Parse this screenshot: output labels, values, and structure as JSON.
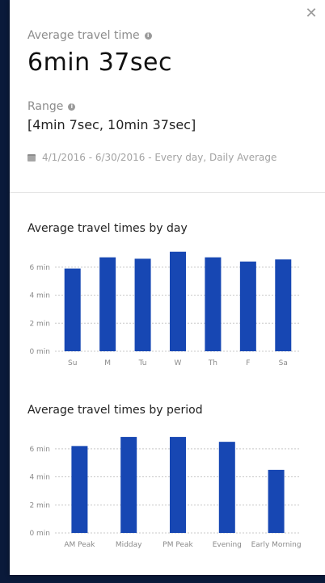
{
  "summary": {
    "avg_label": "Average travel time",
    "avg_value": "6min 37sec",
    "range_label": "Range",
    "range_value": "[4min 7sec, 10min 37sec]",
    "date_info": "4/1/2016 - 6/30/2016 - Every day, Daily Average"
  },
  "icons": {
    "close": "close-icon",
    "info": "info-icon",
    "calendar": "calendar-icon"
  },
  "colors": {
    "bar": "#1747b3",
    "background": "#0a1a3a"
  },
  "chart_data": [
    {
      "type": "bar",
      "title": "Average travel times by day",
      "categories": [
        "Su",
        "M",
        "Tu",
        "W",
        "Th",
        "F",
        "Sa"
      ],
      "values": [
        5.9,
        6.7,
        6.6,
        7.1,
        6.7,
        6.4,
        6.55
      ],
      "ytick_labels": [
        "0 min",
        "2 min",
        "4 min",
        "6 min"
      ],
      "ylim": [
        0,
        7.2
      ]
    },
    {
      "type": "bar",
      "title": "Average travel times by period",
      "categories": [
        "AM Peak",
        "Midday",
        "PM Peak",
        "Evening",
        "Early Morning"
      ],
      "values": [
        6.2,
        6.85,
        6.85,
        6.5,
        4.5
      ],
      "ytick_labels": [
        "0 min",
        "2 min",
        "4 min",
        "6 min"
      ],
      "ylim": [
        0,
        7.2
      ]
    }
  ]
}
